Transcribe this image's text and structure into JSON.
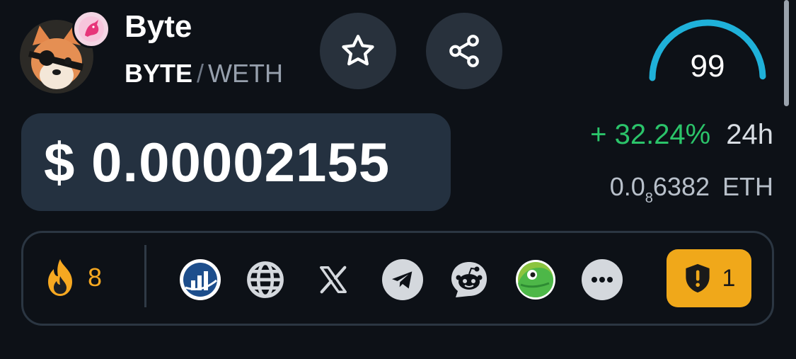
{
  "token": {
    "name": "Byte",
    "base_symbol": "BYTE",
    "separator": "/",
    "quote_symbol": "WETH",
    "avatar_icon": "shiba-eyepatch-logo",
    "dex_icon": "uniswap-unicorn-icon"
  },
  "actions": {
    "favorite_icon": "star-icon",
    "share_icon": "share-icon"
  },
  "score": {
    "value": "99",
    "fraction": 0.99,
    "color": "#1fb1d9"
  },
  "price": {
    "usd": "$ 0.00002155",
    "change": "+ 32.24%",
    "change_period": "24h",
    "change_color": "#2bc46a",
    "eth_prefix": "0.0",
    "eth_zero_count": "8",
    "eth_digits": "6382",
    "eth_unit": "ETH"
  },
  "links": {
    "hot_icon": "flame-icon",
    "hot_count": "8",
    "items": [
      {
        "name": "chart-site-icon"
      },
      {
        "name": "website-globe-icon"
      },
      {
        "name": "x-twitter-icon"
      },
      {
        "name": "telegram-icon"
      },
      {
        "name": "reddit-icon"
      },
      {
        "name": "coingecko-icon"
      },
      {
        "name": "more-icon"
      }
    ],
    "audit_icon": "shield-alert-icon",
    "audit_count": "1",
    "audit_color": "#f0a81a"
  }
}
